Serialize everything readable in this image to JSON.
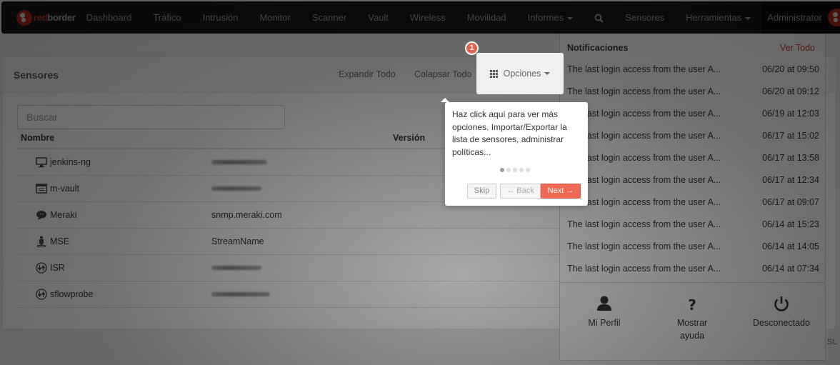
{
  "navbar": {
    "brand": {
      "part1": "red",
      "part2": "border"
    },
    "items": [
      {
        "label": "Dashboard"
      },
      {
        "label": "Tráfico"
      },
      {
        "label": "Intrusión"
      },
      {
        "label": "Monitor"
      },
      {
        "label": "Scanner"
      },
      {
        "label": "Vault"
      },
      {
        "label": "Wireless"
      },
      {
        "label": "Movilidad"
      },
      {
        "label": "Informes",
        "dropdown": true
      }
    ],
    "search_icon": "search-icon",
    "right_items": [
      {
        "label": "Sensores"
      },
      {
        "label": "Herramientas",
        "dropdown": true
      }
    ],
    "user": "Administrator"
  },
  "panel": {
    "title": "Sensores",
    "expand_all": "Expandir Todo",
    "collapse_all": "Colapsar Todo",
    "options": "Opciones",
    "search_placeholder": "Buscar",
    "columns": {
      "name": "Nombre",
      "version": "Versión"
    },
    "rows": [
      {
        "icon": "monitor-icon",
        "name": "jenkins-ng",
        "ip": "",
        "redacted": true
      },
      {
        "icon": "server-list-icon",
        "name": "m-vault",
        "ip": "",
        "redacted": true
      },
      {
        "icon": "chat-bubble-icon",
        "name": "Meraki",
        "ip": "snmp.meraki.com",
        "redacted": false
      },
      {
        "icon": "person-location-icon",
        "name": "MSE",
        "ip": "StreamName",
        "redacted": false
      },
      {
        "icon": "flow-arrows-icon",
        "name": "ISR",
        "ip": "",
        "redacted": true
      },
      {
        "icon": "flow-arrows-icon",
        "name": "sflowprobe",
        "ip": "",
        "redacted": true
      }
    ]
  },
  "tour": {
    "step_number": "1",
    "text": "Haz click aquí para ver más opciones. Importar/Exportar la lista de sensores, administrar políticas...",
    "total_steps": 5,
    "current_step": 1,
    "skip": "Skip",
    "back": "← Back",
    "next": "Next →"
  },
  "notifications": {
    "title": "Notificaciones",
    "view_all": "Ver Todo",
    "items": [
      {
        "message": "The last login access from the user A...",
        "time": "06/20 at 09:50"
      },
      {
        "message": "The last login access from the user A...",
        "time": "06/20 at 09:12"
      },
      {
        "message": "The last login access from the user A...",
        "time": "06/19 at 12:03"
      },
      {
        "message": "The last login access from the user A...",
        "time": "06/17 at 15:02"
      },
      {
        "message": "The last login access from the user A...",
        "time": "06/17 at 13:58"
      },
      {
        "message": "The last login access from the user A...",
        "time": "06/17 at 12:34"
      },
      {
        "message": "The last login access from the user A...",
        "time": "06/17 at 09:07"
      },
      {
        "message": "The last login access from the user A...",
        "time": "06/14 at 15:23"
      },
      {
        "message": "The last login access from the user A...",
        "time": "06/14 at 14:05"
      },
      {
        "message": "The last login access from the user A...",
        "time": "06/14 at 07:34"
      }
    ],
    "actions": [
      {
        "icon": "user-icon",
        "label": "Mi Perfil"
      },
      {
        "icon": "question-icon",
        "label": "Mostrar ayuda"
      },
      {
        "icon": "power-icon",
        "label": "Desconectado"
      }
    ]
  },
  "footer_fragment": "SL",
  "colors": {
    "brand_red": "#c0392b",
    "navbar_bg": "#161616",
    "tour_next": "#ee6a52",
    "badge": "#e8604c"
  }
}
